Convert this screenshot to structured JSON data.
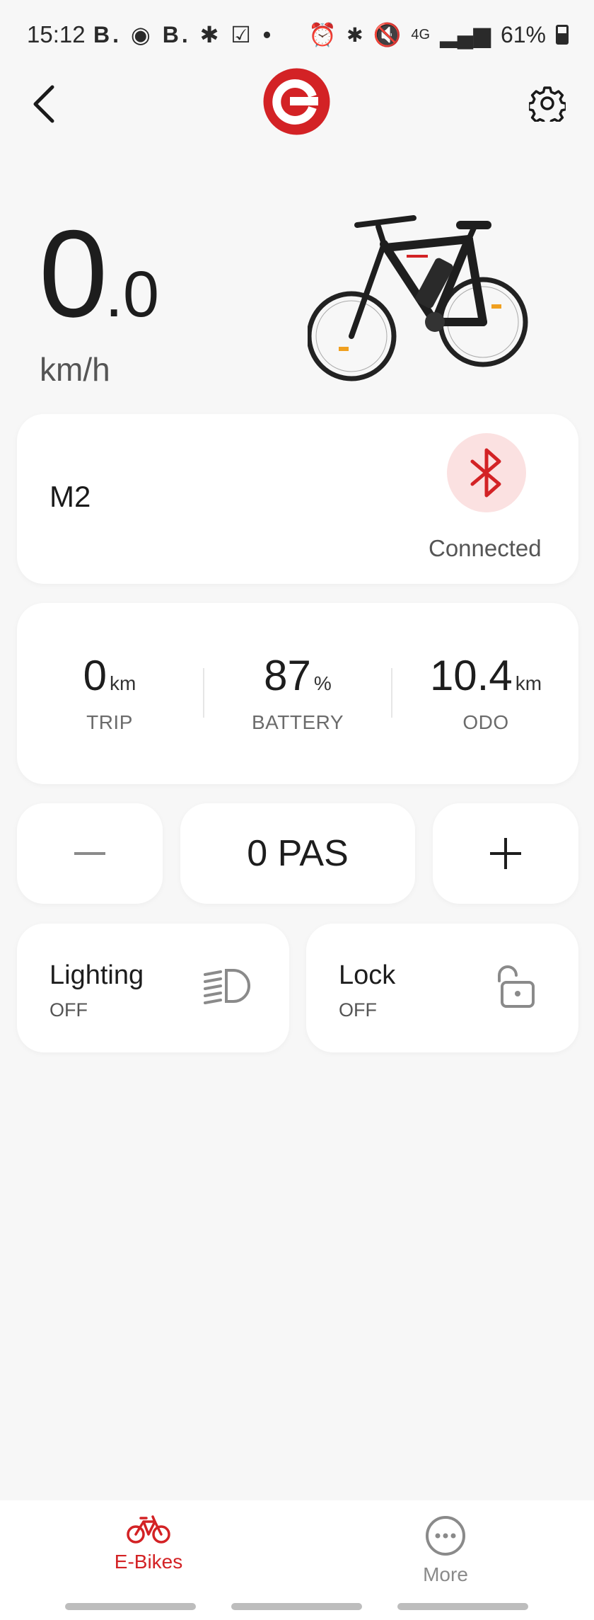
{
  "status_bar": {
    "time": "15:12",
    "left_icons": "B. ◉ B. ✱ ☑ •",
    "network": "4G",
    "battery_percent": "61%"
  },
  "header": {
    "back_icon": "chevron-left-icon",
    "logo_icon": "brand-logo",
    "settings_icon": "gear-icon",
    "brand_color": "#d32225"
  },
  "speed": {
    "integer": "0",
    "decimal": ".0",
    "unit": "km/h"
  },
  "device": {
    "name": "M2",
    "connection_status": "Connected",
    "icon": "bluetooth-icon"
  },
  "stats": [
    {
      "value": "0",
      "unit": "km",
      "label": "TRIP"
    },
    {
      "value": "87",
      "unit": "%",
      "label": "BATTERY"
    },
    {
      "value": "10.4",
      "unit": "km",
      "label": "ODO"
    }
  ],
  "pas": {
    "value": "0 PAS",
    "minus_icon": "minus-icon",
    "plus_icon": "plus-icon"
  },
  "lighting": {
    "title": "Lighting",
    "state": "OFF",
    "icon": "headlight-icon"
  },
  "lock": {
    "title": "Lock",
    "state": "OFF",
    "icon": "unlock-icon"
  },
  "nav": {
    "ebikes_label": "E-Bikes",
    "more_label": "More"
  }
}
